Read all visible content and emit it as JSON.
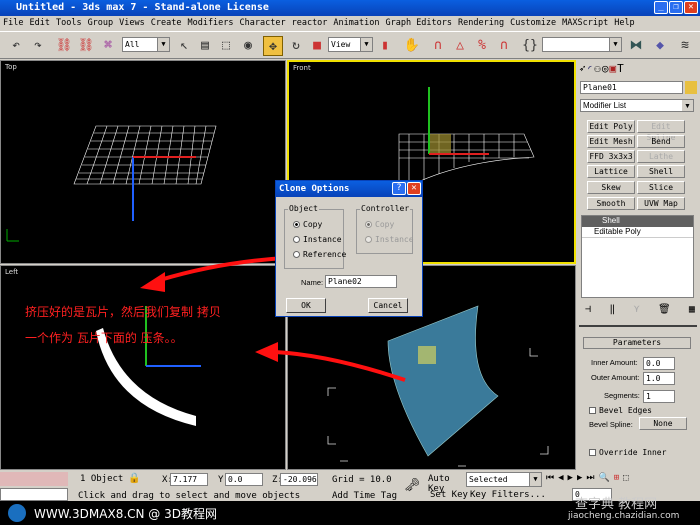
{
  "window": {
    "title": "Untitled - 3ds max 7  - Stand-alone License"
  },
  "menu": [
    "File",
    "Edit",
    "Tools",
    "Group",
    "Views",
    "Create",
    "Modifiers",
    "Character",
    "reactor",
    "Animation",
    "Graph Editors",
    "Rendering",
    "Customize",
    "MAXScript",
    "Help"
  ],
  "toolbar": {
    "selection_filter": "All",
    "reference_coord": "View",
    "named_selection": ""
  },
  "viewports": {
    "top": "Top",
    "front": "Front",
    "left": "Left",
    "perspective": ""
  },
  "annotation": {
    "line1": "挤压好的是瓦片，然后我们复制 拷贝",
    "line2": "一个作为 瓦片下面的 压条。。"
  },
  "dialog": {
    "title": "Clone Options",
    "object_group": "Object",
    "controller_group": "Controller",
    "object_options": [
      "Copy",
      "Instance",
      "Reference"
    ],
    "controller_options": [
      "Copy",
      "Instance"
    ],
    "selected_object": "Copy",
    "name_label": "Name:",
    "name_value": "Plane02",
    "ok": "OK",
    "cancel": "Cancel"
  },
  "panel": {
    "object_name": "Plane01",
    "object_color": "#e8c040",
    "modifier_list": "Modifier List",
    "modifier_buttons": [
      "Edit Poly",
      "Edit Spline",
      "Edit Mesh",
      "Bend",
      "FFD 3x3x3",
      "Lathe",
      "Lattice",
      "Shell",
      "Skew",
      "Slice",
      "Smooth",
      "UVW Map"
    ],
    "stack": [
      "Shell",
      "Editable Poly"
    ],
    "rollout": "Parameters",
    "inner_label": "Inner Amount:",
    "inner_value": "0.0",
    "outer_label": "Outer Amount:",
    "outer_value": "1.0",
    "segments_label": "Segments:",
    "segments_value": "1",
    "bevel_edges": "Bevel Edges",
    "bevel_spline_label": "Bevel Spline:",
    "bevel_spline_value": "None",
    "override_inner": "Override Inner"
  },
  "status": {
    "selection": "1 Object",
    "x": "7.177",
    "y": "0.0",
    "z": "-20.096",
    "grid": "Grid = 10.0",
    "prompt": "Click and drag to select and move objects",
    "add_time_tag": "Add Time Tag",
    "auto_key": "Auto Key",
    "set_key": "Set Key",
    "key_mode": "Selected",
    "key_filters": "Key Filters...",
    "frame": "0"
  },
  "watermark": {
    "left": "WWW.3DMAX8.CN @ 3D教程网",
    "right_top": "查字典 教程网",
    "right_bottom": "jiaocheng.chazidian.com"
  }
}
